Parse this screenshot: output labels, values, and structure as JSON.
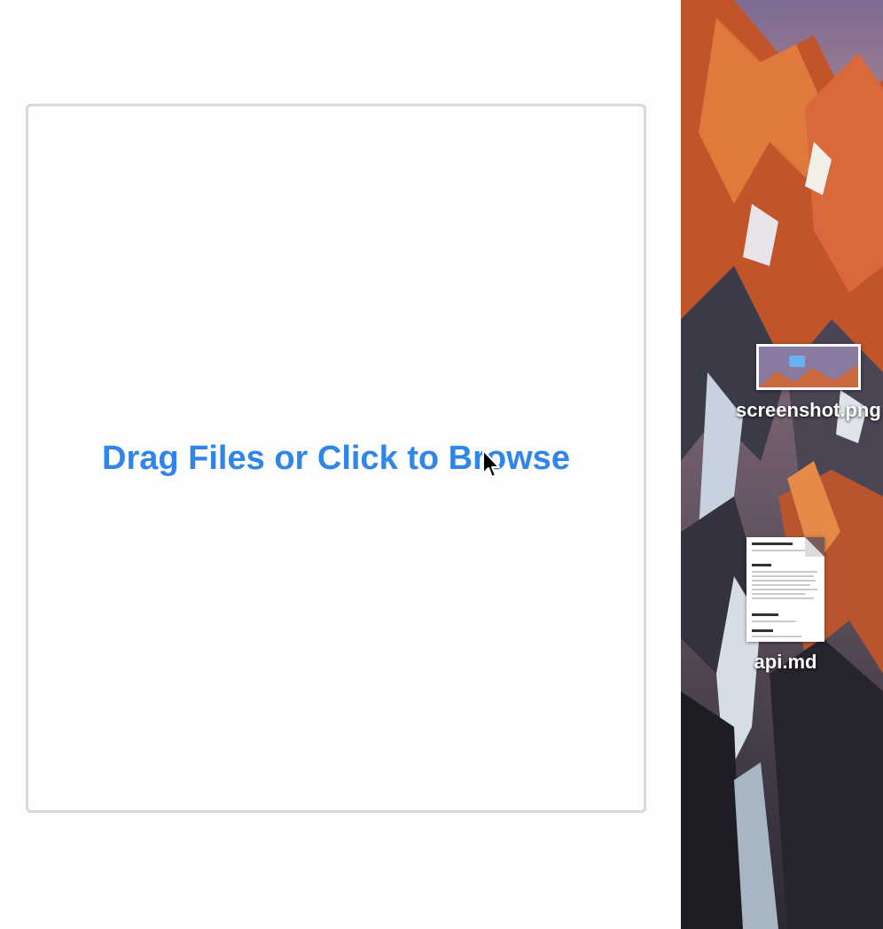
{
  "dropzone": {
    "label": "Drag Files or Click to Browse",
    "accent_color": "#2f86e8",
    "border_color": "#d9d9d9"
  },
  "cursor": {
    "icon": "arrow-cursor-icon"
  },
  "desktop": {
    "items": [
      {
        "label": "screenshot.png",
        "icon": "image-file-icon"
      },
      {
        "label": "api.md",
        "icon": "document-file-icon"
      }
    ]
  }
}
